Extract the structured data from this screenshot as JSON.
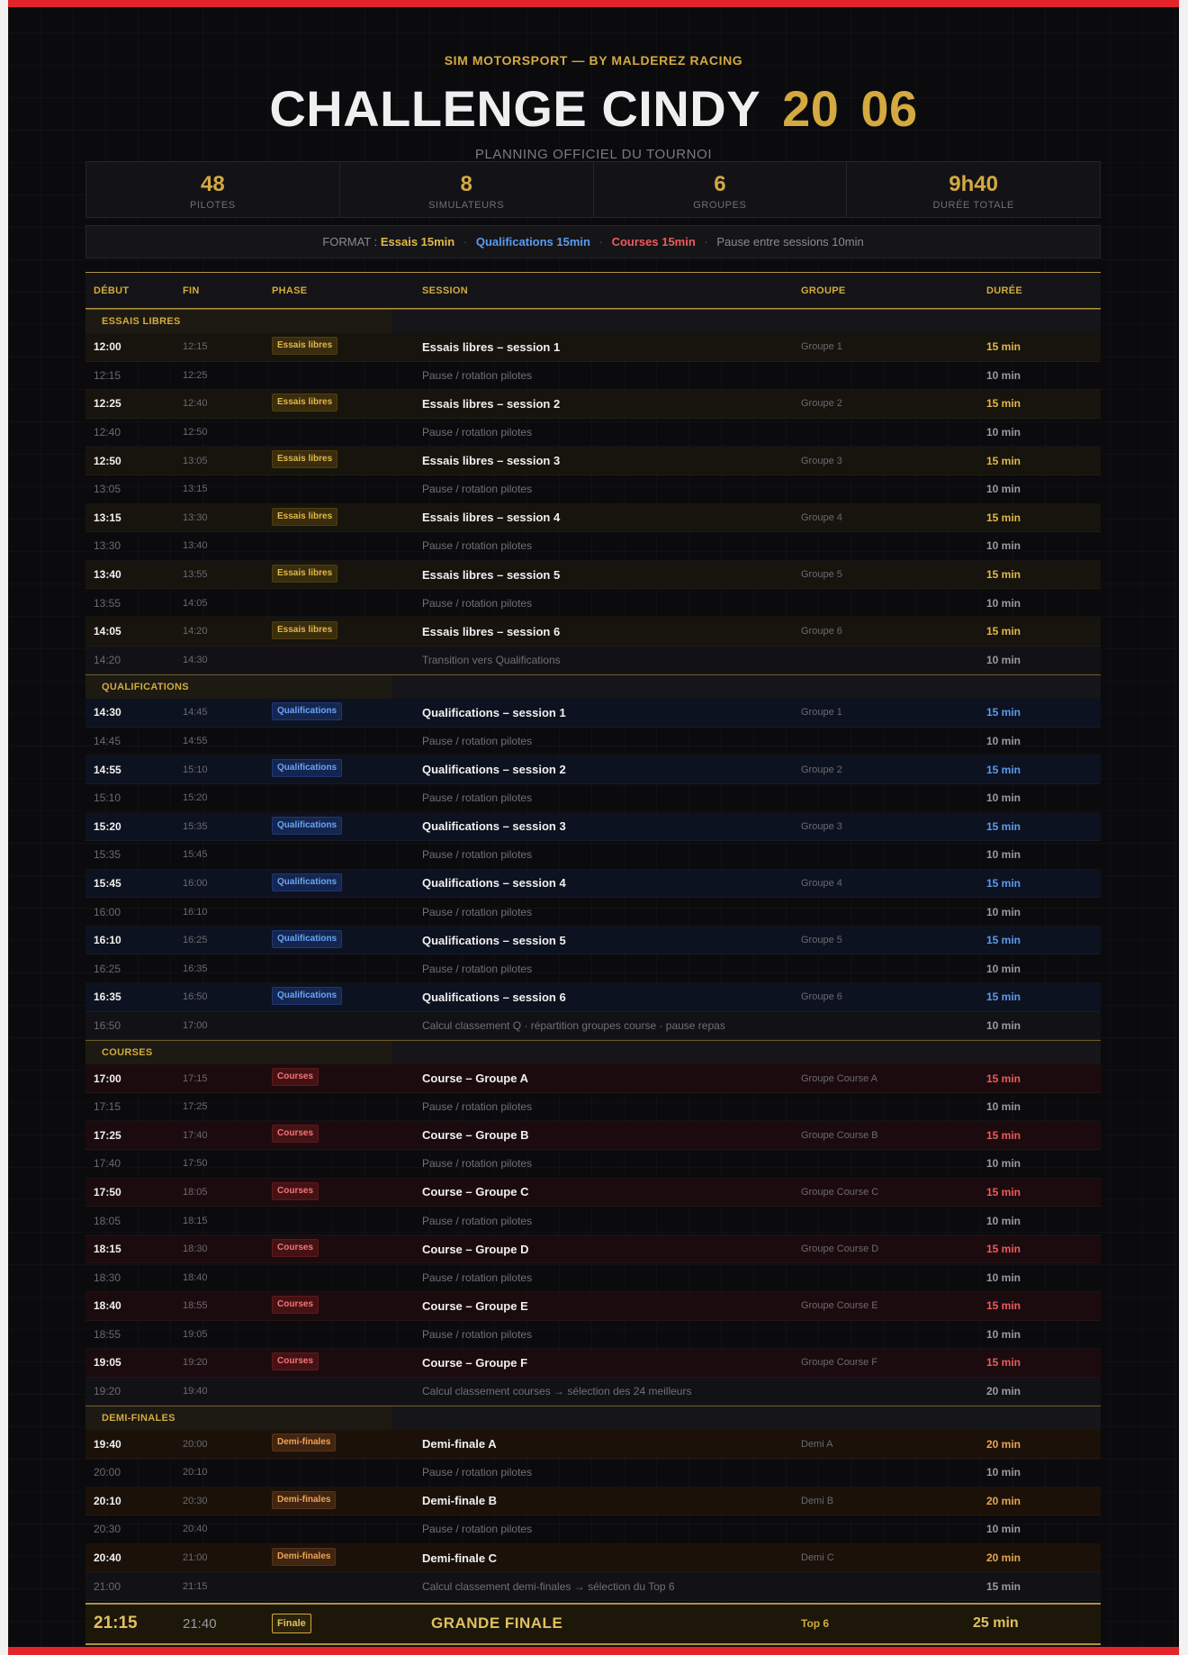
{
  "header": {
    "kicker": "SIM MOTORSPORT  —  BY MALDEREZ RACING",
    "title": "CHALLENGE CINDY",
    "day": "20",
    "month": "06",
    "subtitle": "PLANNING OFFICIEL DU TOURNOI"
  },
  "stats": [
    {
      "value": "48",
      "label": "PILOTES"
    },
    {
      "value": "8",
      "label": "SIMULATEURS"
    },
    {
      "value": "6",
      "label": "GROUPES"
    },
    {
      "value": "9h40",
      "label": "DURÉE TOTALE"
    }
  ],
  "format": {
    "prefix": "FORMAT :",
    "essais": "Essais 15min",
    "quali": "Qualifications 15min",
    "courses": "Courses 15min",
    "pause": "Pause entre sessions 10min",
    "separator": "·"
  },
  "table_headers": {
    "start": "DÉBUT",
    "end": "FIN",
    "phase": "PHASE",
    "session": "SESSION",
    "group": "GROUPE",
    "duration": "DURÉE"
  },
  "sections": [
    {
      "title": "ESSAIS LIBRES",
      "kind": "ess",
      "rows": [
        {
          "type": "session",
          "start": "12:00",
          "end": "12:15",
          "phase": "Essais libres",
          "session": "Essais libres – session 1",
          "group": "Groupe 1",
          "duration": "15 min"
        },
        {
          "type": "pause",
          "start": "12:15",
          "end": "12:25",
          "session": "Pause / rotation pilotes",
          "duration": "10 min"
        },
        {
          "type": "session",
          "start": "12:25",
          "end": "12:40",
          "phase": "Essais libres",
          "session": "Essais libres – session 2",
          "group": "Groupe 2",
          "duration": "15 min"
        },
        {
          "type": "pause",
          "start": "12:40",
          "end": "12:50",
          "session": "Pause / rotation pilotes",
          "duration": "10 min"
        },
        {
          "type": "session",
          "start": "12:50",
          "end": "13:05",
          "phase": "Essais libres",
          "session": "Essais libres – session 3",
          "group": "Groupe 3",
          "duration": "15 min"
        },
        {
          "type": "pause",
          "start": "13:05",
          "end": "13:15",
          "session": "Pause / rotation pilotes",
          "duration": "10 min"
        },
        {
          "type": "session",
          "start": "13:15",
          "end": "13:30",
          "phase": "Essais libres",
          "session": "Essais libres – session 4",
          "group": "Groupe 4",
          "duration": "15 min"
        },
        {
          "type": "pause",
          "start": "13:30",
          "end": "13:40",
          "session": "Pause / rotation pilotes",
          "duration": "10 min"
        },
        {
          "type": "session",
          "start": "13:40",
          "end": "13:55",
          "phase": "Essais libres",
          "session": "Essais libres – session 5",
          "group": "Groupe 5",
          "duration": "15 min"
        },
        {
          "type": "pause",
          "start": "13:55",
          "end": "14:05",
          "session": "Pause / rotation pilotes",
          "duration": "10 min"
        },
        {
          "type": "session",
          "start": "14:05",
          "end": "14:20",
          "phase": "Essais libres",
          "session": "Essais libres – session 6",
          "group": "Groupe 6",
          "duration": "15 min"
        },
        {
          "type": "trans",
          "start": "14:20",
          "end": "14:30",
          "session": "Transition vers Qualifications",
          "duration": "10 min"
        }
      ]
    },
    {
      "title": "QUALIFICATIONS",
      "kind": "qua",
      "rows": [
        {
          "type": "session",
          "start": "14:30",
          "end": "14:45",
          "phase": "Qualifications",
          "session": "Qualifications – session 1",
          "group": "Groupe 1",
          "duration": "15 min"
        },
        {
          "type": "pause",
          "start": "14:45",
          "end": "14:55",
          "session": "Pause / rotation pilotes",
          "duration": "10 min"
        },
        {
          "type": "session",
          "start": "14:55",
          "end": "15:10",
          "phase": "Qualifications",
          "session": "Qualifications – session 2",
          "group": "Groupe 2",
          "duration": "15 min"
        },
        {
          "type": "pause",
          "start": "15:10",
          "end": "15:20",
          "session": "Pause / rotation pilotes",
          "duration": "10 min"
        },
        {
          "type": "session",
          "start": "15:20",
          "end": "15:35",
          "phase": "Qualifications",
          "session": "Qualifications – session 3",
          "group": "Groupe 3",
          "duration": "15 min"
        },
        {
          "type": "pause",
          "start": "15:35",
          "end": "15:45",
          "session": "Pause / rotation pilotes",
          "duration": "10 min"
        },
        {
          "type": "session",
          "start": "15:45",
          "end": "16:00",
          "phase": "Qualifications",
          "session": "Qualifications – session 4",
          "group": "Groupe 4",
          "duration": "15 min"
        },
        {
          "type": "pause",
          "start": "16:00",
          "end": "16:10",
          "session": "Pause / rotation pilotes",
          "duration": "10 min"
        },
        {
          "type": "session",
          "start": "16:10",
          "end": "16:25",
          "phase": "Qualifications",
          "session": "Qualifications – session 5",
          "group": "Groupe 5",
          "duration": "15 min"
        },
        {
          "type": "pause",
          "start": "16:25",
          "end": "16:35",
          "session": "Pause / rotation pilotes",
          "duration": "10 min"
        },
        {
          "type": "session",
          "start": "16:35",
          "end": "16:50",
          "phase": "Qualifications",
          "session": "Qualifications – session 6",
          "group": "Groupe 6",
          "duration": "15 min"
        },
        {
          "type": "trans",
          "start": "16:50",
          "end": "17:00",
          "session": "Calcul classement Q · répartition groupes course · pause repas",
          "duration": "10 min"
        }
      ]
    },
    {
      "title": "COURSES",
      "kind": "cou",
      "rows": [
        {
          "type": "session",
          "start": "17:00",
          "end": "17:15",
          "phase": "Courses",
          "session": "Course – Groupe A",
          "group": "Groupe Course A",
          "duration": "15 min"
        },
        {
          "type": "pause",
          "start": "17:15",
          "end": "17:25",
          "session": "Pause / rotation pilotes",
          "duration": "10 min"
        },
        {
          "type": "session",
          "start": "17:25",
          "end": "17:40",
          "phase": "Courses",
          "session": "Course – Groupe B",
          "group": "Groupe Course B",
          "duration": "15 min"
        },
        {
          "type": "pause",
          "start": "17:40",
          "end": "17:50",
          "session": "Pause / rotation pilotes",
          "duration": "10 min"
        },
        {
          "type": "session",
          "start": "17:50",
          "end": "18:05",
          "phase": "Courses",
          "session": "Course – Groupe C",
          "group": "Groupe Course C",
          "duration": "15 min"
        },
        {
          "type": "pause",
          "start": "18:05",
          "end": "18:15",
          "session": "Pause / rotation pilotes",
          "duration": "10 min"
        },
        {
          "type": "session",
          "start": "18:15",
          "end": "18:30",
          "phase": "Courses",
          "session": "Course – Groupe D",
          "group": "Groupe Course D",
          "duration": "15 min"
        },
        {
          "type": "pause",
          "start": "18:30",
          "end": "18:40",
          "session": "Pause / rotation pilotes",
          "duration": "10 min"
        },
        {
          "type": "session",
          "start": "18:40",
          "end": "18:55",
          "phase": "Courses",
          "session": "Course – Groupe E",
          "group": "Groupe Course E",
          "duration": "15 min"
        },
        {
          "type": "pause",
          "start": "18:55",
          "end": "19:05",
          "session": "Pause / rotation pilotes",
          "duration": "10 min"
        },
        {
          "type": "session",
          "start": "19:05",
          "end": "19:20",
          "phase": "Courses",
          "session": "Course – Groupe F",
          "group": "Groupe Course F",
          "duration": "15 min"
        },
        {
          "type": "trans",
          "start": "19:20",
          "end": "19:40",
          "session": "Calcul classement courses → sélection des 24 meilleurs",
          "duration": "20 min"
        }
      ]
    },
    {
      "title": "DEMI-FINALES",
      "kind": "dem",
      "rows": [
        {
          "type": "session",
          "start": "19:40",
          "end": "20:00",
          "phase": "Demi-finales",
          "session": "Demi-finale A",
          "group": "Demi A",
          "duration": "20 min"
        },
        {
          "type": "pause",
          "start": "20:00",
          "end": "20:10",
          "session": "Pause / rotation pilotes",
          "duration": "10 min"
        },
        {
          "type": "session",
          "start": "20:10",
          "end": "20:30",
          "phase": "Demi-finales",
          "session": "Demi-finale B",
          "group": "Demi B",
          "duration": "20 min"
        },
        {
          "type": "pause",
          "start": "20:30",
          "end": "20:40",
          "session": "Pause / rotation pilotes",
          "duration": "10 min"
        },
        {
          "type": "session",
          "start": "20:40",
          "end": "21:00",
          "phase": "Demi-finales",
          "session": "Demi-finale C",
          "group": "Demi C",
          "duration": "20 min"
        },
        {
          "type": "trans",
          "start": "21:00",
          "end": "21:15",
          "session": "Calcul classement demi-finales → sélection du Top 6",
          "duration": "15 min"
        }
      ]
    }
  ],
  "final": {
    "start": "21:15",
    "end": "21:40",
    "phase": "Finale",
    "session": "GRANDE FINALE",
    "group": "Top 6",
    "duration": "25 min"
  },
  "colors": {
    "accent_gold": "#d4a93f",
    "essais": "#e2b84a",
    "qualifications": "#5b9bf0",
    "courses": "#ee5a5e",
    "demi_finales": "#e8a650",
    "top_bar": "#e3242b"
  }
}
